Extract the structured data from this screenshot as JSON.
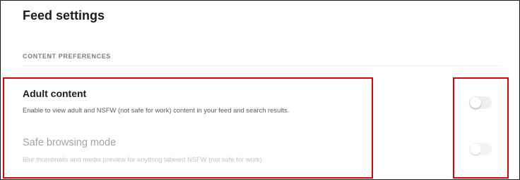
{
  "page": {
    "title": "Feed settings"
  },
  "section": {
    "label": "CONTENT PREFERENCES"
  },
  "settings": [
    {
      "title": "Adult content",
      "description": "Enable to view adult and NSFW (not safe for work) content in your feed and search results.",
      "enabled": false,
      "disabled": false
    },
    {
      "title": "Safe browsing mode",
      "description": "Blur thumbnails and media preview for anything labeled NSFW (not safe for work).",
      "enabled": false,
      "disabled": true
    }
  ],
  "colors": {
    "highlight": "#e00000",
    "toggle_off": "#edeff1",
    "toggle_disabled": "#f2f3f4"
  }
}
